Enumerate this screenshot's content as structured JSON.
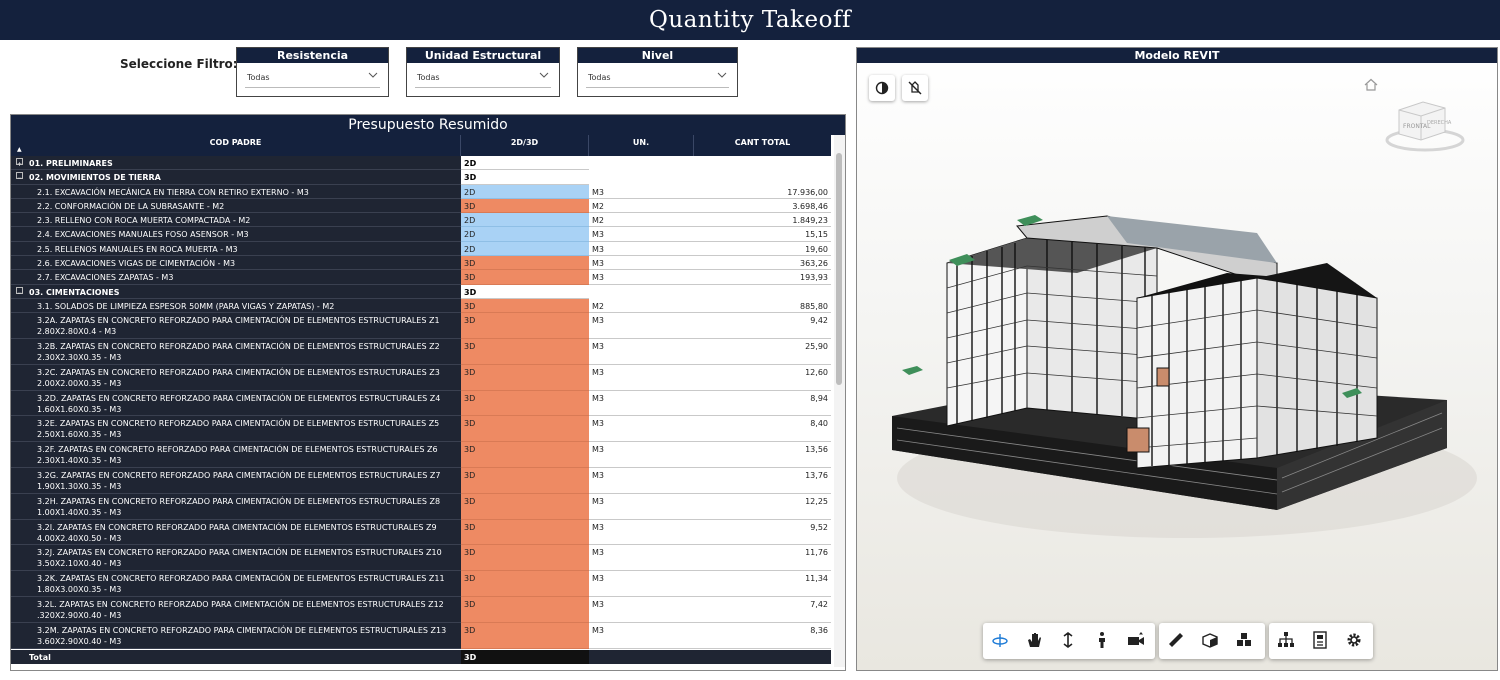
{
  "header": {
    "title": "Quantity Takeoff"
  },
  "filters": {
    "label": "Seleccione Filtro:",
    "slicers": [
      {
        "title": "Resistencia",
        "value": "Todas"
      },
      {
        "title": "Unidad Estructural",
        "value": "Todas"
      },
      {
        "title": "Nivel",
        "value": "Todas"
      }
    ]
  },
  "table": {
    "title": "Presupuesto Resumido",
    "columns": [
      "COD PADRE",
      "2D/3D",
      "UN.",
      "CANT TOTAL"
    ],
    "rows": [
      {
        "type": "group",
        "label": "01. PRELIMINARES",
        "dim": "2D",
        "expand": "+"
      },
      {
        "type": "group",
        "label": "02. MOVIMIENTOS DE TIERRA",
        "dim": "3D",
        "expand": "−"
      },
      {
        "type": "item",
        "label": "2.1. EXCAVACIÓN MECÁNICA EN TIERRA CON RETIRO EXTERNO - M3",
        "dim": "2D",
        "un": "M3",
        "qty": "17.936,00"
      },
      {
        "type": "item",
        "label": "2.2. CONFORMACIÓN DE LA SUBRASANTE - M2",
        "dim": "3D",
        "un": "M2",
        "qty": "3.698,46"
      },
      {
        "type": "item",
        "label": "2.3. RELLENO CON ROCA MUERTA COMPACTADA - M2",
        "dim": "2D",
        "un": "M2",
        "qty": "1.849,23"
      },
      {
        "type": "item",
        "label": "2.4. EXCAVACIONES MANUALES FOSO ASENSOR - M3",
        "dim": "2D",
        "un": "M3",
        "qty": "15,15"
      },
      {
        "type": "item",
        "label": "2.5. RELLENOS MANUALES EN ROCA MUERTA - M3",
        "dim": "2D",
        "un": "M3",
        "qty": "19,60"
      },
      {
        "type": "item",
        "label": "2.6. EXCAVACIONES VIGAS DE CIMENTACIÓN - M3",
        "dim": "3D",
        "un": "M3",
        "qty": "363,26"
      },
      {
        "type": "item",
        "label": "2.7. EXCAVACIONES ZAPATAS - M3",
        "dim": "3D",
        "un": "M3",
        "qty": "193,93"
      },
      {
        "type": "group",
        "label": "03. CIMENTACIONES",
        "dim": "3D",
        "expand": "−"
      },
      {
        "type": "item",
        "label": "3.1. SOLADOS DE LIMPIEZA ESPESOR 50MM (PARA VIGAS Y ZAPATAS) - M2",
        "dim": "3D",
        "un": "M2",
        "qty": "885,80"
      },
      {
        "type": "item2",
        "label": "3.2A. ZAPATAS EN CONCRETO REFORZADO PARA CIMENTACIÓN DE ELEMENTOS ESTRUCTURALES Z1",
        "label2": "2.80X2.80X0.4 - M3",
        "dim": "3D",
        "un": "M3",
        "qty": "9,42"
      },
      {
        "type": "item2",
        "label": "3.2B. ZAPATAS EN CONCRETO REFORZADO PARA CIMENTACIÓN DE ELEMENTOS ESTRUCTURALES Z2",
        "label2": "2.30X2.30X0.35 - M3",
        "dim": "3D",
        "un": "M3",
        "qty": "25,90"
      },
      {
        "type": "item2",
        "label": "3.2C. ZAPATAS EN CONCRETO REFORZADO PARA CIMENTACIÓN DE ELEMENTOS ESTRUCTURALES Z3",
        "label2": "2.00X2.00X0.35 - M3",
        "dim": "3D",
        "un": "M3",
        "qty": "12,60"
      },
      {
        "type": "item2",
        "label": "3.2D. ZAPATAS EN CONCRETO REFORZADO PARA CIMENTACIÓN DE ELEMENTOS ESTRUCTURALES Z4",
        "label2": "1.60X1.60X0.35 - M3",
        "dim": "3D",
        "un": "M3",
        "qty": "8,94"
      },
      {
        "type": "item2",
        "label": "3.2E. ZAPATAS EN CONCRETO REFORZADO PARA CIMENTACIÓN DE ELEMENTOS ESTRUCTURALES Z5",
        "label2": "2.50X1.60X0.35 - M3",
        "dim": "3D",
        "un": "M3",
        "qty": "8,40"
      },
      {
        "type": "item2",
        "label": "3.2F. ZAPATAS EN CONCRETO REFORZADO PARA CIMENTACIÓN DE ELEMENTOS ESTRUCTURALES Z6",
        "label2": "2.30X1.40X0.35 - M3",
        "dim": "3D",
        "un": "M3",
        "qty": "13,56"
      },
      {
        "type": "item2",
        "label": "3.2G. ZAPATAS EN CONCRETO REFORZADO PARA CIMENTACIÓN DE ELEMENTOS ESTRUCTURALES Z7",
        "label2": "1.90X1.30X0.35 - M3",
        "dim": "3D",
        "un": "M3",
        "qty": "13,76"
      },
      {
        "type": "item2",
        "label": "3.2H. ZAPATAS EN CONCRETO REFORZADO PARA CIMENTACIÓN DE ELEMENTOS ESTRUCTURALES Z8",
        "label2": "1.00X1.40X0.35 - M3",
        "dim": "3D",
        "un": "M3",
        "qty": "12,25"
      },
      {
        "type": "item2",
        "label": "3.2I. ZAPATAS EN CONCRETO REFORZADO PARA CIMENTACIÓN DE ELEMENTOS ESTRUCTURALES Z9",
        "label2": "4.00X2.40X0.50 - M3",
        "dim": "3D",
        "un": "M3",
        "qty": "9,52"
      },
      {
        "type": "item2",
        "label": "3.2J. ZAPATAS EN CONCRETO REFORZADO PARA CIMENTACIÓN DE ELEMENTOS ESTRUCTURALES Z10",
        "label2": "3.50X2.10X0.40 - M3",
        "dim": "3D",
        "un": "M3",
        "qty": "11,76"
      },
      {
        "type": "item2",
        "label": "3.2K. ZAPATAS EN CONCRETO REFORZADO PARA CIMENTACIÓN DE ELEMENTOS ESTRUCTURALES Z11",
        "label2": "1.80X3.00X0.35 - M3",
        "dim": "3D",
        "un": "M3",
        "qty": "11,34"
      },
      {
        "type": "item2",
        "label": "3.2L. ZAPATAS EN CONCRETO REFORZADO PARA CIMENTACIÓN DE ELEMENTOS ESTRUCTURALES Z12",
        "label2": ".320X2.90X0.40 - M3",
        "dim": "3D",
        "un": "M3",
        "qty": "7,42"
      },
      {
        "type": "item2",
        "label": "3.2M. ZAPATAS EN CONCRETO REFORZADO PARA CIMENTACIÓN DE ELEMENTOS ESTRUCTURALES Z13",
        "label2": "3.60X2.90X0.40 - M3",
        "dim": "3D",
        "un": "M3",
        "qty": "8,36"
      }
    ],
    "total": {
      "label": "Total",
      "dim": "3D"
    }
  },
  "viewer": {
    "title": "Modelo REVIT",
    "viewcube_labels": [
      "FRONTAL",
      "DERECHA"
    ]
  },
  "colors": {
    "header_bg": "#14213d",
    "dim_2d": "#a9d2f5",
    "dim_3d": "#ee8a63",
    "row_dark": "#1f2533"
  },
  "icons": {
    "view_buttons": [
      "contrast-icon",
      "hide-icon"
    ],
    "toolbar": [
      "orbit-icon",
      "pan-icon",
      "zoom-icon",
      "first-person-icon",
      "camera-icon",
      "measure-icon",
      "section-icon",
      "explode-icon",
      "model-browser-icon",
      "properties-icon",
      "settings-icon"
    ]
  }
}
